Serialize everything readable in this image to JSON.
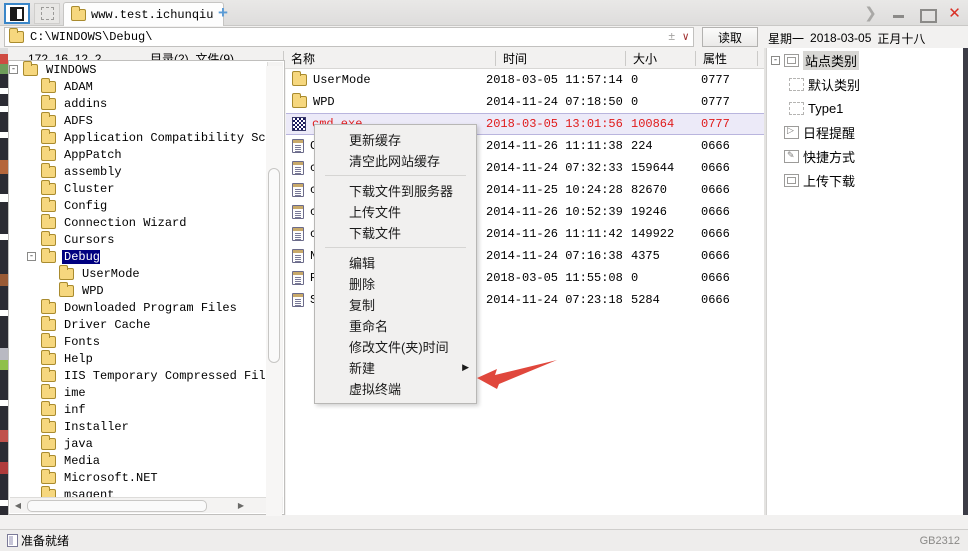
{
  "window": {
    "tab_label": "www.test.ichunqiu",
    "add_tab": "+",
    "controls": {
      "expand": "❯",
      "minimize": "minimize-icon",
      "maximize": "maximize-icon",
      "close": "✕"
    }
  },
  "address_bar": {
    "path": "C:\\WINDOWS\\Debug\\",
    "plus_minus": "±",
    "dropdown": "∨",
    "read_button": "读取"
  },
  "date_header": {
    "weekday": "星期一",
    "date": "2018-03-05",
    "lunar": "正月十八"
  },
  "sub_header": {
    "host": "172. 16. 12. 2",
    "counts": "目录(2), 文件(9)",
    "columns": [
      "名称",
      "时间",
      "大小",
      "属性"
    ]
  },
  "tree": {
    "nodes": [
      {
        "label": "WINDOWS",
        "indent": 0,
        "toggle": "-",
        "selected": false
      },
      {
        "label": "ADAM",
        "indent": 1,
        "toggle": "",
        "selected": false
      },
      {
        "label": "addins",
        "indent": 1,
        "toggle": "",
        "selected": false
      },
      {
        "label": "ADFS",
        "indent": 1,
        "toggle": "",
        "selected": false
      },
      {
        "label": "Application Compatibility Scrip",
        "indent": 1,
        "toggle": "",
        "selected": false
      },
      {
        "label": "AppPatch",
        "indent": 1,
        "toggle": "",
        "selected": false
      },
      {
        "label": "assembly",
        "indent": 1,
        "toggle": "",
        "selected": false
      },
      {
        "label": "Cluster",
        "indent": 1,
        "toggle": "",
        "selected": false
      },
      {
        "label": "Config",
        "indent": 1,
        "toggle": "",
        "selected": false
      },
      {
        "label": "Connection Wizard",
        "indent": 1,
        "toggle": "",
        "selected": false
      },
      {
        "label": "Cursors",
        "indent": 1,
        "toggle": "",
        "selected": false
      },
      {
        "label": "Debug",
        "indent": 1,
        "toggle": "-",
        "selected": true
      },
      {
        "label": "UserMode",
        "indent": 2,
        "toggle": "",
        "selected": false
      },
      {
        "label": "WPD",
        "indent": 2,
        "toggle": "",
        "selected": false
      },
      {
        "label": "Downloaded Program Files",
        "indent": 1,
        "toggle": "",
        "selected": false
      },
      {
        "label": "Driver Cache",
        "indent": 1,
        "toggle": "",
        "selected": false
      },
      {
        "label": "Fonts",
        "indent": 1,
        "toggle": "",
        "selected": false
      },
      {
        "label": "Help",
        "indent": 1,
        "toggle": "",
        "selected": false
      },
      {
        "label": "IIS Temporary Compressed Files",
        "indent": 1,
        "toggle": "",
        "selected": false
      },
      {
        "label": "ime",
        "indent": 1,
        "toggle": "",
        "selected": false
      },
      {
        "label": "inf",
        "indent": 1,
        "toggle": "",
        "selected": false
      },
      {
        "label": "Installer",
        "indent": 1,
        "toggle": "",
        "selected": false
      },
      {
        "label": "java",
        "indent": 1,
        "toggle": "",
        "selected": false
      },
      {
        "label": "Media",
        "indent": 1,
        "toggle": "",
        "selected": false
      },
      {
        "label": "Microsoft.NET",
        "indent": 1,
        "toggle": "",
        "selected": false
      },
      {
        "label": "msagent",
        "indent": 1,
        "toggle": "",
        "selected": false
      }
    ]
  },
  "files": {
    "rows": [
      {
        "name": "UserMode",
        "icon": "folder",
        "time": "2018-03-05 11:57:14",
        "size": "0",
        "attr": "0777",
        "selected": false
      },
      {
        "name": "WPD",
        "icon": "folder",
        "time": "2014-11-24 07:18:50",
        "size": "0",
        "attr": "0777",
        "selected": false
      },
      {
        "name": "cmd.exe",
        "icon": "exe",
        "time": "2018-03-05 13:01:56",
        "size": "100864",
        "attr": "0777",
        "selected": true
      },
      {
        "name": "C",
        "icon": "file",
        "time": "2014-11-26 11:11:38",
        "size": "224",
        "attr": "0666",
        "selected": false
      },
      {
        "name": "c",
        "icon": "file",
        "time": "2014-11-24 07:32:33",
        "size": "159644",
        "attr": "0666",
        "selected": false
      },
      {
        "name": "c",
        "icon": "file",
        "time": "2014-11-25 10:24:28",
        "size": "82670",
        "attr": "0666",
        "selected": false
      },
      {
        "name": "c",
        "icon": "file",
        "time": "2014-11-26 10:52:39",
        "size": "19246",
        "attr": "0666",
        "selected": false
      },
      {
        "name": "c",
        "icon": "file",
        "time": "2014-11-26 11:11:42",
        "size": "149922",
        "attr": "0666",
        "selected": false
      },
      {
        "name": "N",
        "icon": "file",
        "time": "2014-11-24 07:16:38",
        "size": "4375",
        "attr": "0666",
        "selected": false
      },
      {
        "name": "P",
        "icon": "file",
        "time": "2018-03-05 11:55:08",
        "size": "0",
        "attr": "0666",
        "selected": false
      },
      {
        "name": "S",
        "icon": "file",
        "time": "2014-11-24 07:23:18",
        "size": "5284",
        "attr": "0666",
        "selected": false
      }
    ]
  },
  "context_menu": {
    "items": [
      {
        "label": "更新缓存",
        "submenu": false,
        "sep_after": false
      },
      {
        "label": "清空此网站缓存",
        "submenu": false,
        "sep_after": true
      },
      {
        "label": "下载文件到服务器",
        "submenu": false,
        "sep_after": false
      },
      {
        "label": "上传文件",
        "submenu": false,
        "sep_after": false
      },
      {
        "label": "下载文件",
        "submenu": false,
        "sep_after": true
      },
      {
        "label": "编辑",
        "submenu": false,
        "sep_after": false
      },
      {
        "label": "删除",
        "submenu": false,
        "sep_after": false
      },
      {
        "label": "复制",
        "submenu": false,
        "sep_after": false
      },
      {
        "label": "重命名",
        "submenu": false,
        "sep_after": false
      },
      {
        "label": "修改文件(夹)时间",
        "submenu": false,
        "sep_after": false
      },
      {
        "label": "新建",
        "submenu": true,
        "sep_after": false
      },
      {
        "label": "虚拟终端",
        "submenu": false,
        "sep_after": false
      }
    ],
    "submenu_arrow": "▶"
  },
  "right_panel": {
    "nodes": [
      {
        "label": "站点类别",
        "indent": 0,
        "toggle": "-",
        "icon": "box-icon",
        "selected": true
      },
      {
        "label": "默认类别",
        "indent": 1,
        "toggle": "",
        "icon": "dashed-box-icon",
        "selected": false
      },
      {
        "label": "Type1",
        "indent": 1,
        "toggle": "",
        "icon": "dashed-box-icon",
        "selected": false
      },
      {
        "label": "日程提醒",
        "indent": 0,
        "toggle": "",
        "icon": "play-icon",
        "selected": false
      },
      {
        "label": "快捷方式",
        "indent": 0,
        "toggle": "",
        "icon": "hand-icon",
        "selected": false
      },
      {
        "label": "上传下载",
        "indent": 0,
        "toggle": "",
        "icon": "box-icon",
        "selected": false
      }
    ]
  },
  "status_bar": {
    "message": "准备就绪",
    "encoding": "GB2312"
  },
  "colors": {
    "selection_blue": "#000080",
    "selected_row_bg": "#eceaf8",
    "selected_row_text": "#e01b1b",
    "accent_red": "#d93025",
    "arrow_red": "#e0473c"
  }
}
